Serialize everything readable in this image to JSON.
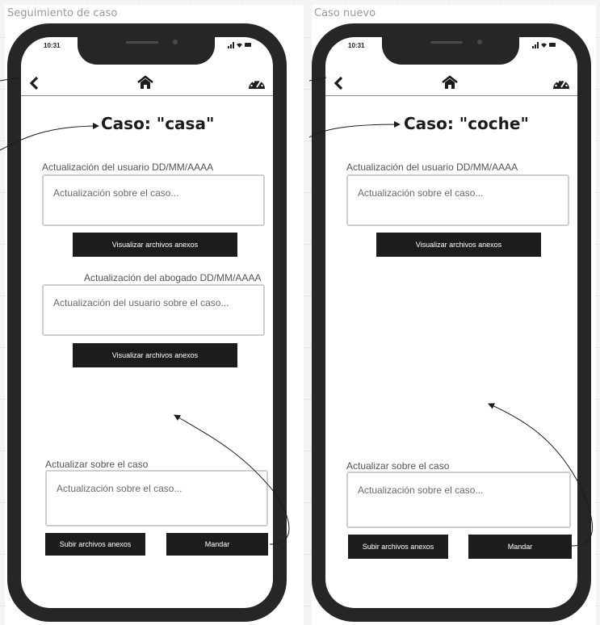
{
  "frames": [
    {
      "frame_label": "Seguimiento de caso",
      "status_time": "10:31",
      "case_title": "Caso: \"casa\"",
      "user_update_label": "Actualización del usuario DD/MM/AAAA",
      "user_update_text": "Actualización sobre el caso...",
      "view_files_button": "Visualizar archivos anexos",
      "lawyer_update_label": "Actualización del abogado DD/MM/AAAA",
      "lawyer_update_text": "Actualización del usuario sobre el caso...",
      "lawyer_view_files_button": "Visualizar archivos anexos",
      "update_case_label": "Actualizar sobre el caso",
      "update_case_placeholder": "Actualización sobre el caso...",
      "upload_button": "Subir archivos anexos",
      "send_button": "Mandar"
    },
    {
      "frame_label": "Caso nuevo",
      "status_time": "10:31",
      "case_title": "Caso: \"coche\"",
      "user_update_label": "Actualización del usuario DD/MM/AAAA",
      "user_update_text": "Actualización sobre el caso...",
      "view_files_button": "Visualizar archivos anexos",
      "update_case_label": "Actualizar sobre el caso",
      "update_case_placeholder": "Actualización sobre el caso...",
      "upload_button": "Subir archivos anexos",
      "send_button": "Mandar"
    }
  ],
  "icons": {
    "back": "chevron-left-icon",
    "home": "home-icon",
    "dashboard": "speedometer-icon",
    "status": "signal-wifi-battery-icon"
  },
  "colors": {
    "button_bg": "#1c1c1c",
    "phone_frame": "#262626",
    "textbox_border": "#cfcfcf"
  }
}
